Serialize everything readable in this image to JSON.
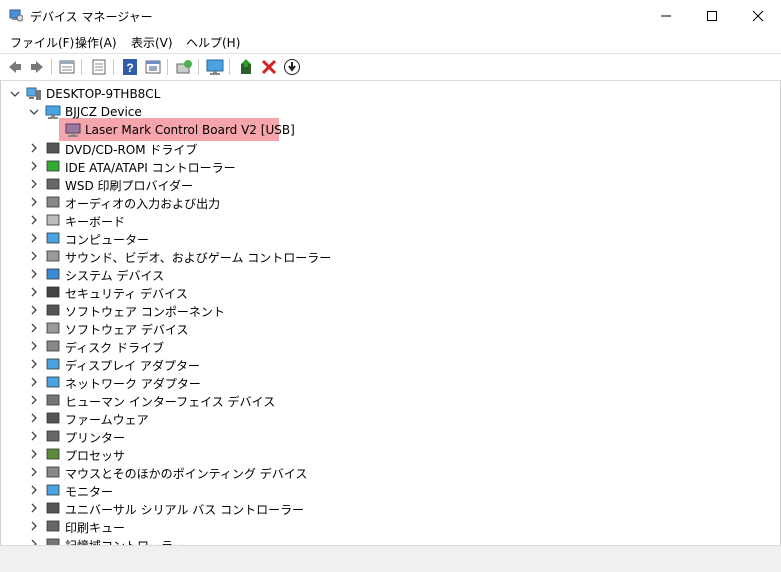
{
  "window": {
    "title": "デバイス マネージャー",
    "controls": [
      "minimize",
      "maximize",
      "close"
    ]
  },
  "menu": [
    {
      "label": "ファイル(F)"
    },
    {
      "label": "操作(A)"
    },
    {
      "label": "表示(V)"
    },
    {
      "label": "ヘルプ(H)"
    }
  ],
  "toolbar": [
    "back-icon",
    "forward-icon",
    "properties-icon",
    "update-list-icon",
    "help-icon",
    "action-icon",
    "scan-hardware-icon",
    "monitor-icon",
    "enable-driver-icon",
    "uninstall-icon",
    "download-icon"
  ],
  "tree": {
    "root": "DESKTOP-9THB8CL",
    "group": "BJJCZ Device",
    "selected_child": "Laser Mark Control Board V2 [USB]",
    "items": [
      {
        "label": "DVD/CD-ROM ドライブ",
        "icon": "dvd-drive-icon"
      },
      {
        "label": "IDE ATA/ATAPI コントローラー",
        "icon": "ide-controller-icon"
      },
      {
        "label": "WSD 印刷プロバイダー",
        "icon": "printer-provider-icon"
      },
      {
        "label": "オーディオの入力および出力",
        "icon": "speaker-icon"
      },
      {
        "label": "キーボード",
        "icon": "keyboard-icon"
      },
      {
        "label": "コンピューター",
        "icon": "computer-icon"
      },
      {
        "label": "サウンド、ビデオ、およびゲーム コントローラー",
        "icon": "sound-icon"
      },
      {
        "label": "システム デバイス",
        "icon": "system-device-icon"
      },
      {
        "label": "セキュリティ デバイス",
        "icon": "security-device-icon"
      },
      {
        "label": "ソフトウェア コンポーネント",
        "icon": "software-component-icon"
      },
      {
        "label": "ソフトウェア デバイス",
        "icon": "software-device-icon"
      },
      {
        "label": "ディスク ドライブ",
        "icon": "disk-drive-icon"
      },
      {
        "label": "ディスプレイ アダプター",
        "icon": "display-adapter-icon"
      },
      {
        "label": "ネットワーク アダプター",
        "icon": "network-adapter-icon"
      },
      {
        "label": "ヒューマン インターフェイス デバイス",
        "icon": "hid-icon"
      },
      {
        "label": "ファームウェア",
        "icon": "firmware-icon"
      },
      {
        "label": "プリンター",
        "icon": "printer-icon"
      },
      {
        "label": "プロセッサ",
        "icon": "processor-icon"
      },
      {
        "label": "マウスとそのほかのポインティング デバイス",
        "icon": "mouse-icon"
      },
      {
        "label": "モニター",
        "icon": "monitor-icon"
      },
      {
        "label": "ユニバーサル シリアル バス コントローラー",
        "icon": "usb-icon"
      },
      {
        "label": "印刷キュー",
        "icon": "print-queue-icon"
      },
      {
        "label": "記憶域コントローラー",
        "icon": "storage-controller-icon"
      }
    ]
  }
}
